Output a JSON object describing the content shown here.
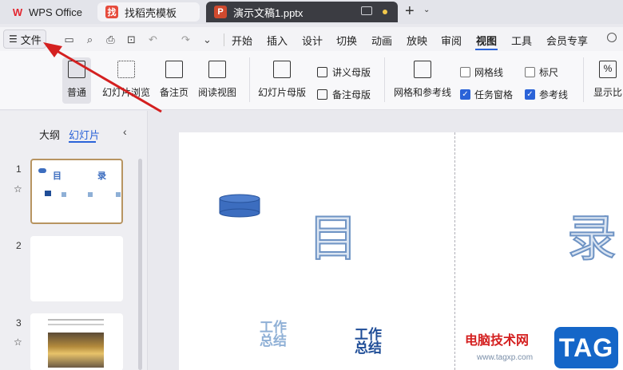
{
  "tabs": [
    {
      "label": "WPS Office",
      "icon": "wps-logo-icon"
    },
    {
      "label": "找稻壳模板",
      "icon": "docer-logo-icon"
    },
    {
      "label": "演示文稿1.pptx",
      "icon": "presentation-logo-icon"
    }
  ],
  "menubar": {
    "file_label": "文件",
    "items": [
      "开始",
      "插入",
      "设计",
      "切换",
      "动画",
      "放映",
      "审阅",
      "视图",
      "工具",
      "会员专享"
    ],
    "active": "视图"
  },
  "ribbon": {
    "normal": "普通",
    "slide_sorter": "幻灯片浏览",
    "notes_page": "备注页",
    "reading_view": "阅读视图",
    "slide_master": "幻灯片母版",
    "handout_master": "讲义母版",
    "notes_master": "备注母版",
    "grid_guides": "网格和参考线",
    "gridlines": {
      "label": "网格线",
      "checked": false
    },
    "ruler": {
      "label": "标尺",
      "checked": false
    },
    "task_pane": {
      "label": "任务窗格",
      "checked": true
    },
    "guides": {
      "label": "参考线",
      "checked": true
    },
    "show_ratio": "显示比"
  },
  "panel": {
    "outline_tab": "大纲",
    "slides_tab": "幻灯片",
    "slides": [
      {
        "number": "1",
        "title_left": "目",
        "title_right": "录"
      },
      {
        "number": "2"
      },
      {
        "number": "3"
      }
    ]
  },
  "slide": {
    "char_left": "目",
    "char_right": "录",
    "text1_line1": "工作",
    "text1_line2": "总结",
    "text2_line1": "工作",
    "text2_line2": "总结"
  },
  "watermark": {
    "text": "电脑技术网",
    "url": "www.tagxp.com",
    "tag": "TAG"
  },
  "colors": {
    "accent": "#2b63d8",
    "selected_thumb": "#b79461",
    "shape_fill": "#3c6dbf"
  }
}
